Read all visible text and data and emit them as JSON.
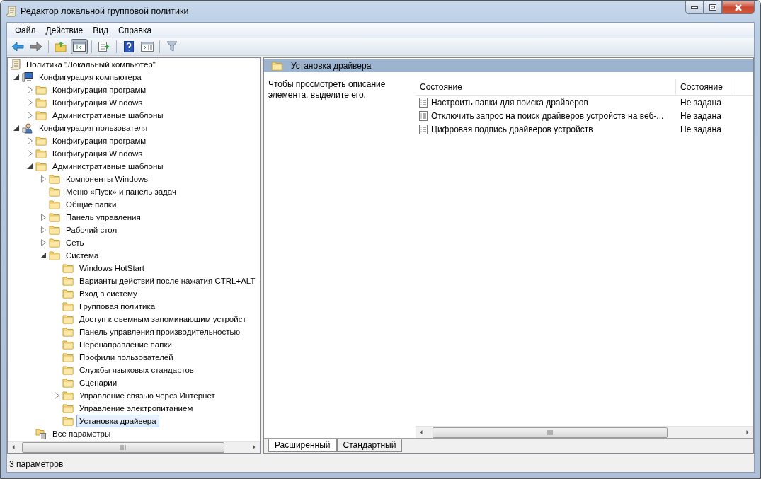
{
  "window": {
    "title": "Редактор локальной групповой политики"
  },
  "menu": [
    "Файл",
    "Действие",
    "Вид",
    "Справка"
  ],
  "toolbar": [
    {
      "kind": "back",
      "pressed": false
    },
    {
      "kind": "forward",
      "pressed": false
    },
    {
      "kind": "sep"
    },
    {
      "kind": "up",
      "pressed": false
    },
    {
      "kind": "tree",
      "pressed": true
    },
    {
      "kind": "sep"
    },
    {
      "kind": "export",
      "pressed": false
    },
    {
      "kind": "sep"
    },
    {
      "kind": "help",
      "pressed": false
    },
    {
      "kind": "panel",
      "pressed": false
    },
    {
      "kind": "sep"
    },
    {
      "kind": "filter",
      "pressed": false
    }
  ],
  "tree": [
    {
      "label": "Политика \"Локальный компьютер\"",
      "kind": "policy",
      "selected": false,
      "children": [
        {
          "label": "Конфигурация компьютера",
          "kind": "computer",
          "expanded": true,
          "selected": false,
          "children": [
            {
              "label": "Конфигурация программ",
              "kind": "folder",
              "expanded": false,
              "selected": false
            },
            {
              "label": "Конфигурация Windows",
              "kind": "folder",
              "expanded": false,
              "selected": false
            },
            {
              "label": "Административные шаблоны",
              "kind": "folder",
              "expanded": false,
              "selected": false
            }
          ]
        },
        {
          "label": "Конфигурация пользователя",
          "kind": "user",
          "expanded": true,
          "selected": false,
          "children": [
            {
              "label": "Конфигурация программ",
              "kind": "folder",
              "expanded": false,
              "selected": false
            },
            {
              "label": "Конфигурация Windows",
              "kind": "folder",
              "expanded": false,
              "selected": false
            },
            {
              "label": "Административные шаблоны",
              "kind": "folder",
              "expanded": true,
              "selected": false,
              "children": [
                {
                  "label": "Компоненты Windows",
                  "kind": "folder",
                  "expanded": false,
                  "selected": false
                },
                {
                  "label": "Меню «Пуск» и панель задач",
                  "kind": "folder",
                  "selected": false
                },
                {
                  "label": "Общие папки",
                  "kind": "folder",
                  "selected": false
                },
                {
                  "label": "Панель управления",
                  "kind": "folder",
                  "expanded": false,
                  "selected": false
                },
                {
                  "label": "Рабочий стол",
                  "kind": "folder",
                  "expanded": false,
                  "selected": false
                },
                {
                  "label": "Сеть",
                  "kind": "folder",
                  "expanded": false,
                  "selected": false
                },
                {
                  "label": "Система",
                  "kind": "folder",
                  "expanded": true,
                  "selected": false,
                  "children": [
                    {
                      "label": "Windows HotStart",
                      "kind": "folder",
                      "selected": false
                    },
                    {
                      "label": "Варианты действий после нажатия CTRL+ALT",
                      "kind": "folder",
                      "selected": false
                    },
                    {
                      "label": "Вход в систему",
                      "kind": "folder",
                      "selected": false
                    },
                    {
                      "label": "Групповая политика",
                      "kind": "folder",
                      "selected": false
                    },
                    {
                      "label": "Доступ к съемным запоминающим устройст",
                      "kind": "folder",
                      "selected": false
                    },
                    {
                      "label": "Панель управления производительностью",
                      "kind": "folder",
                      "selected": false
                    },
                    {
                      "label": "Перенаправление папки",
                      "kind": "folder",
                      "selected": false
                    },
                    {
                      "label": "Профили пользователей",
                      "kind": "folder",
                      "selected": false
                    },
                    {
                      "label": "Службы языковых стандартов",
                      "kind": "folder",
                      "selected": false
                    },
                    {
                      "label": "Сценарии",
                      "kind": "folder",
                      "selected": false
                    },
                    {
                      "label": "Управление связью через Интернет",
                      "kind": "folder",
                      "expanded": false,
                      "selected": false
                    },
                    {
                      "label": "Управление электропитанием",
                      "kind": "folder",
                      "selected": false
                    },
                    {
                      "label": "Установка драйвера",
                      "kind": "folder",
                      "selected": true
                    }
                  ]
                }
              ]
            },
            {
              "label": "Все параметры",
              "kind": "all-settings",
              "selected": false
            }
          ]
        }
      ]
    }
  ],
  "detail": {
    "header": "Установка драйвера",
    "description": "Чтобы просмотреть описание элемента, выделите его.",
    "columns": [
      "Состояние",
      "Состояние"
    ],
    "rows": [
      {
        "name": "Настроить папки для поиска драйверов",
        "state": "Не задана"
      },
      {
        "name": "Отключить запрос на поиск драйверов устройств на веб-...",
        "state": "Не задана"
      },
      {
        "name": "Цифровая подпись драйверов устройств",
        "state": "Не задана"
      }
    ]
  },
  "tabs": [
    {
      "label": "Расширенный",
      "selected": true
    },
    {
      "label": "Стандартный",
      "selected": false
    }
  ],
  "status_bar": "3 параметров"
}
